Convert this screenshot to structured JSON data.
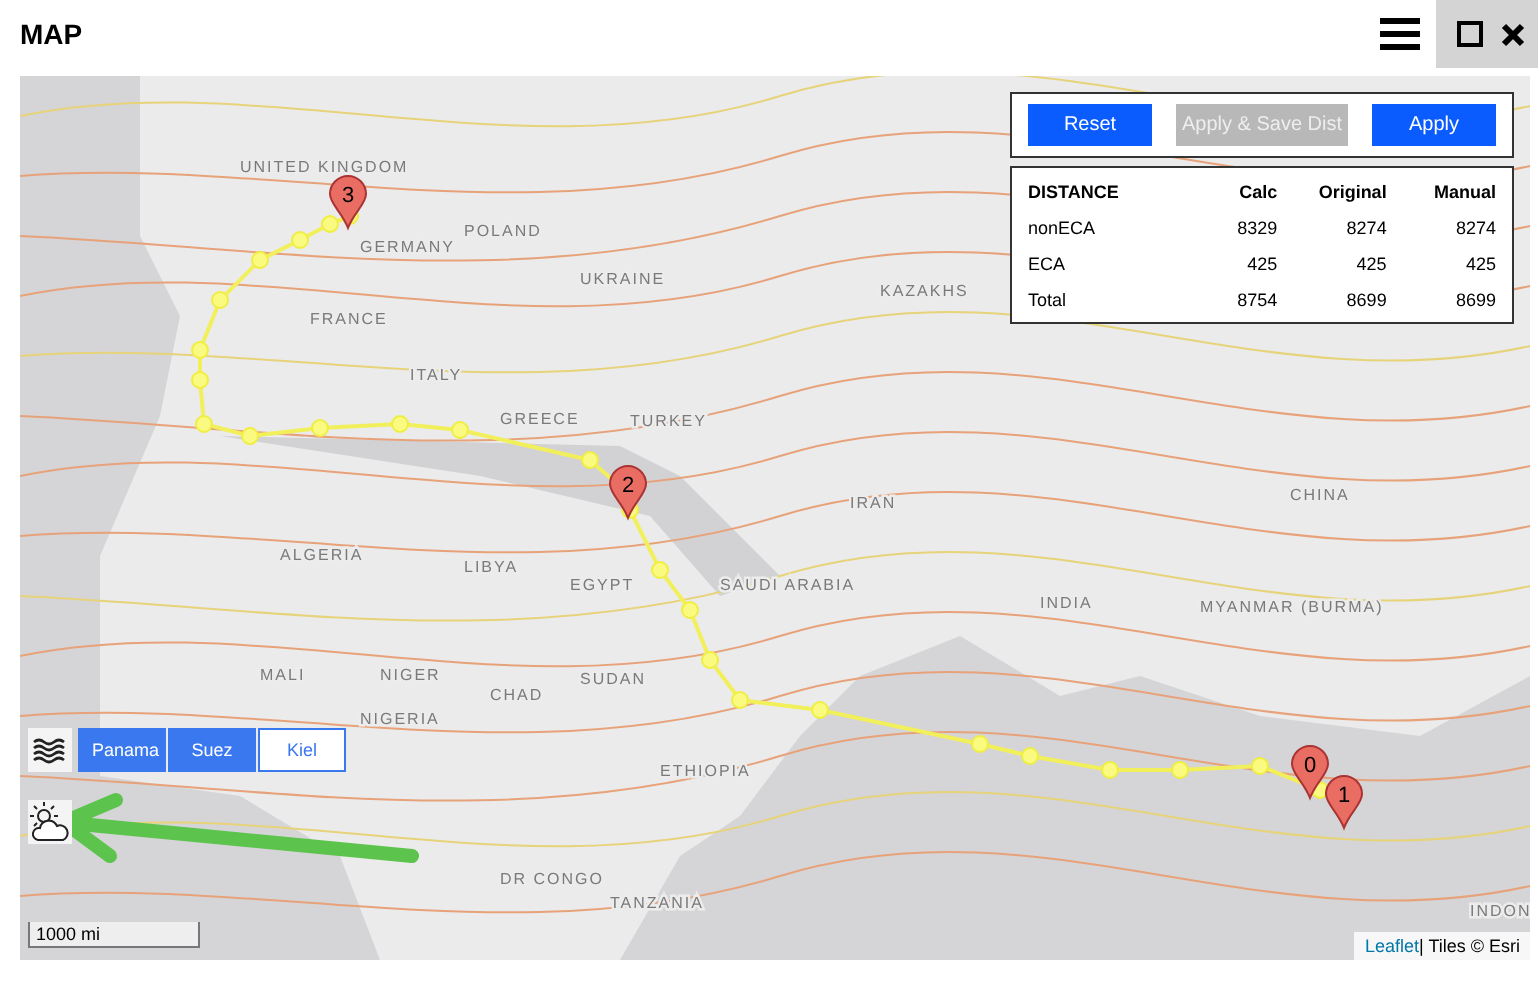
{
  "window": {
    "title": "MAP"
  },
  "buttons": [
    {
      "label": "Reset",
      "disabled": false
    },
    {
      "label": "Apply & Save Dist",
      "disabled": true
    },
    {
      "label": "Apply",
      "disabled": false
    }
  ],
  "distance_table": {
    "columns": [
      "DISTANCE",
      "Calc",
      "Original",
      "Manual"
    ],
    "rows": [
      [
        "nonECA",
        "8329",
        "8274",
        "8274"
      ],
      [
        "ECA",
        "425",
        "425",
        "425"
      ],
      [
        "Total",
        "8754",
        "8699",
        "8699"
      ]
    ]
  },
  "map_labels": [
    "UNITED KINGDOM",
    "GERMANY",
    "POLAND",
    "UKRAINE",
    "FRANCE",
    "KAZAKHS",
    "ITALY",
    "GREECE",
    "TURKEY",
    "IRAN",
    "ALGERIA",
    "LIBYA",
    "EGYPT",
    "SAUDI ARABIA",
    "CHINA",
    "MALI",
    "NIGER",
    "CHAD",
    "SUDAN",
    "INDIA",
    "MYANMAR (BURMA)",
    "NIGERIA",
    "ETHIOPIA",
    "DR CONGO",
    "TANZANIA",
    "INDON"
  ],
  "markers": [
    "0",
    "1",
    "2",
    "3"
  ],
  "canal_toggles": [
    {
      "label": "Panama",
      "selected": true
    },
    {
      "label": "Suez",
      "selected": true
    },
    {
      "label": "Kiel",
      "selected": false
    }
  ],
  "scale": "1000 mi",
  "attribution": {
    "link": "Leaflet",
    "text": "| Tiles © Esri"
  }
}
